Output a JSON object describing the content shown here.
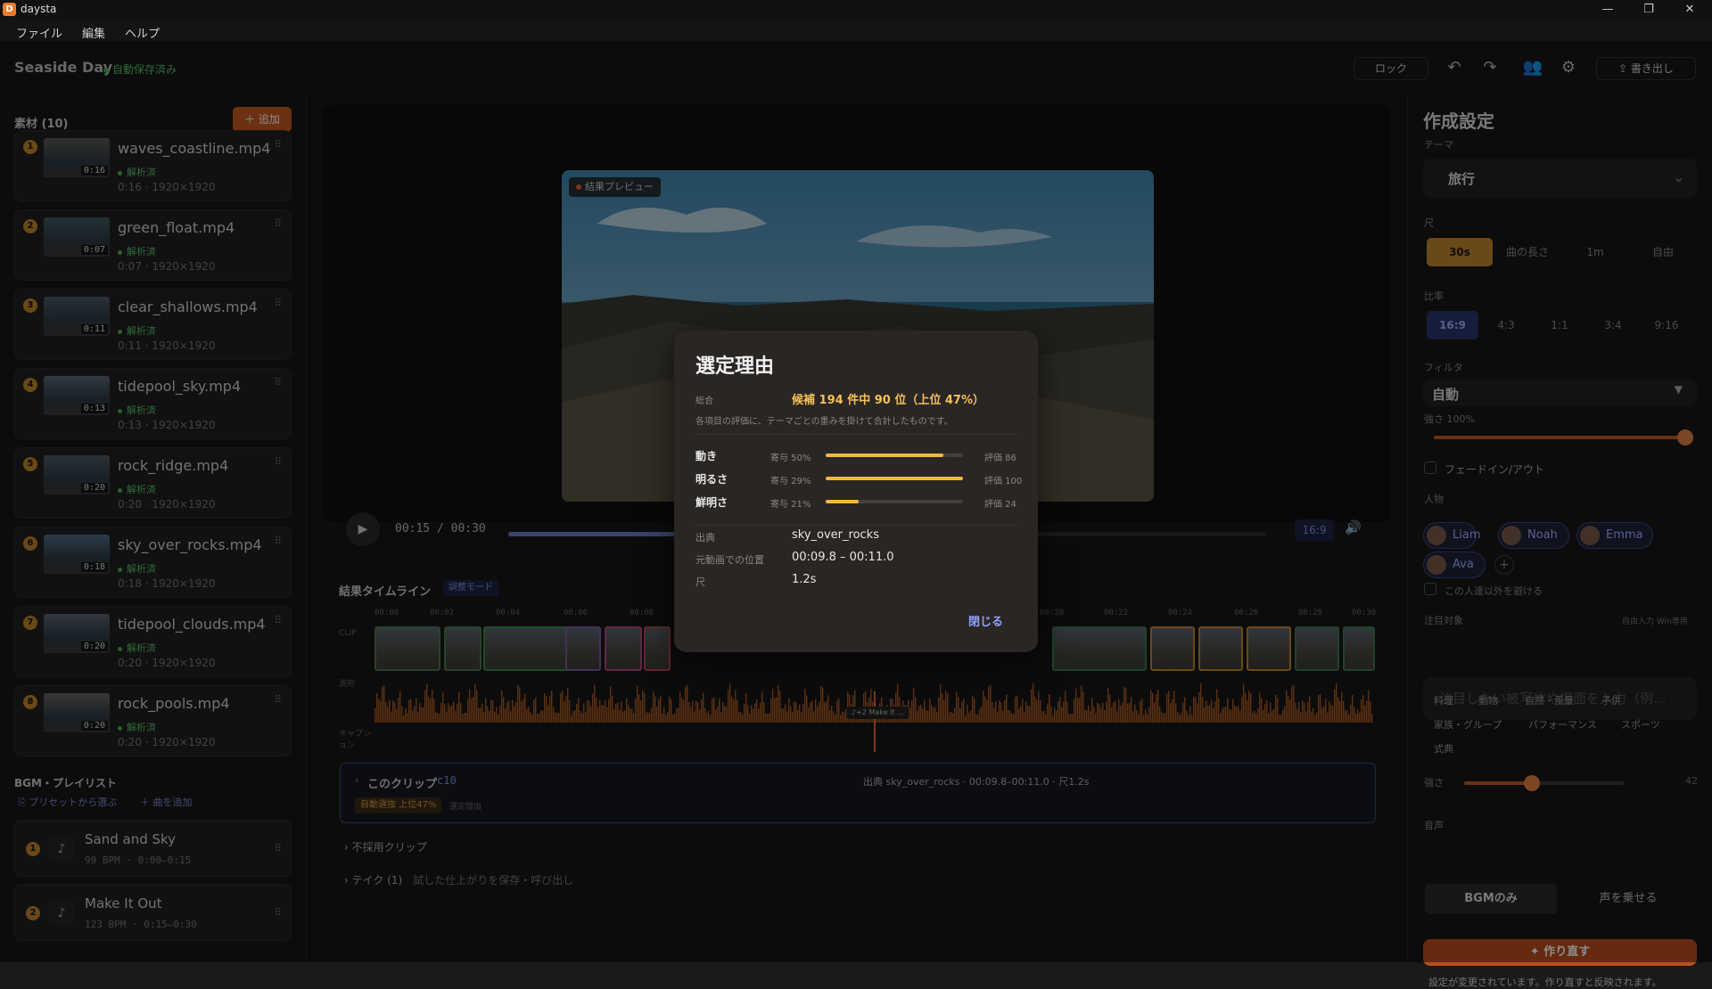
{
  "titlebar": {
    "app_name": "daysta",
    "icon_letter": "D",
    "minimize": "—",
    "maximize": "❐",
    "close": "✕"
  },
  "menubar": {
    "items": [
      "ファイル",
      "編集",
      "ヘルプ"
    ]
  },
  "header": {
    "project_title": "Seaside Day",
    "autosave": "自動保存済み",
    "lock_label": "ロック",
    "export_label": "書き出し"
  },
  "materials": {
    "title": "素材 (10)",
    "add_label": "＋ 追加",
    "clips": [
      {
        "num": "1",
        "name": "waves_coastline.mp4",
        "duration": "0:16",
        "status": "解析済",
        "meta": "0:16 · 1920×1920",
        "thumb": "#5b5a54"
      },
      {
        "num": "2",
        "name": "green_float.mp4",
        "duration": "0:07",
        "status": "解析済",
        "meta": "0:07 · 1920×1920",
        "thumb": "#3f5a66"
      },
      {
        "num": "3",
        "name": "clear_shallows.mp4",
        "duration": "0:11",
        "status": "解析済",
        "meta": "0:11 · 1920×1920",
        "thumb": "#4a5a68"
      },
      {
        "num": "4",
        "name": "tidepool_sky.mp4",
        "duration": "0:13",
        "status": "解析済",
        "meta": "0:13 · 1920×1920",
        "thumb": "#5a6878"
      },
      {
        "num": "5",
        "name": "rock_ridge.mp4",
        "duration": "0:20",
        "status": "解析済",
        "meta": "0:20 · 1920×1920",
        "thumb": "#4e5a66"
      },
      {
        "num": "6",
        "name": "sky_over_rocks.mp4",
        "duration": "0:18",
        "status": "解析済",
        "meta": "0:18 · 1920×1920",
        "thumb": "#4f6c8a"
      },
      {
        "num": "7",
        "name": "tidepool_clouds.mp4",
        "duration": "0:20",
        "status": "解析済",
        "meta": "0:20 · 1920×1920",
        "thumb": "#5a6470"
      },
      {
        "num": "8",
        "name": "rock_pools.mp4",
        "duration": "0:20",
        "status": "解析済",
        "meta": "0:20 · 1920×1920",
        "thumb": "#6a6660"
      }
    ]
  },
  "bgm": {
    "title": "BGM・プレイリスト",
    "preset_link": "プリセットから選ぶ",
    "add_link": "＋ 曲を追加",
    "tracks": [
      {
        "num": "1",
        "name": "Sand and Sky",
        "meta": "99 BPM · 0:00–0:15"
      },
      {
        "num": "2",
        "name": "Make It Out",
        "meta": "123 BPM · 0:15–0:30"
      }
    ]
  },
  "preview": {
    "tag": "結果プレビュー",
    "time": "00:15 / 00:30",
    "progress": 0.5,
    "ratio": "16:9"
  },
  "timeline": {
    "title": "結果タイムライン",
    "mode": "調整モード",
    "ticks": [
      "00:00",
      "00:02",
      "00:04",
      "00:06",
      "00:08",
      "00:20",
      "00:22",
      "00:24",
      "00:26",
      "00:28",
      "00:30"
    ],
    "row_clip": "CLIP",
    "row_audio": "波形",
    "row_caption": "キャプション",
    "playhead_label": "♪+2 Make It …"
  },
  "clip_info": {
    "title": "このクリップ",
    "id": "c10",
    "meta": "出典 sky_over_rocks · 00:09.8–00:11.0 · 尺1.2s",
    "badge": "自動選抜 上位47%",
    "sub": "選定理由"
  },
  "collapsibles": {
    "rejected": "不採用クリップ",
    "takes": "テイク (1)",
    "takes_sub": "試した仕上がりを保存・呼び出し"
  },
  "settings": {
    "title": "作成設定",
    "theme_label": "テーマ",
    "theme_value": "旅行",
    "length_label": "尺",
    "length_options": [
      "30s",
      "曲の長さ",
      "1m",
      "自由"
    ],
    "ratio_label": "比率",
    "ratio_options": [
      "16:9",
      "4:3",
      "1:1",
      "3:4",
      "9:16"
    ],
    "filter_label": "フィルタ",
    "filter_value": "自動",
    "strength_label": "強さ 100%",
    "strength": 1.0,
    "fade_label": "フェードイン/アウト",
    "people_label": "人物",
    "people": [
      "Liam",
      "Noah",
      "Emma",
      "Ava"
    ],
    "avoid_label": "この人達以外を避ける",
    "focus_label": "注目対象",
    "focus_hint": "自由入力 Win専用",
    "focus_placeholder": "注目したい被写体や場面を入力（例…",
    "tags": [
      "料理",
      "動物",
      "自然・風景",
      "子供",
      "家族・グループ",
      "パフォーマンス",
      "スポーツ",
      "式典"
    ],
    "focus_strength_label": "強さ",
    "focus_strength_value": "42",
    "focus_strength": 0.42,
    "audio_label": "音声",
    "audio_options": [
      "BGMのみ",
      "声を乗せる"
    ],
    "remake_label": "作り直す",
    "remake_note": "設定が変更されています。作り直すと反映されます。"
  },
  "modal": {
    "title": "選定理由",
    "overall_label": "総合",
    "rank": "候補 194 件中 90 位（上位 47%）",
    "note": "各項目の評価に、テーマごとの重みを掛けて合計したものです。",
    "metrics": [
      {
        "name": "動き",
        "weight": "寄与 50%",
        "value": 0.86,
        "score": "評価 86"
      },
      {
        "name": "明るさ",
        "weight": "寄与 29%",
        "value": 1.0,
        "score": "評価 100"
      },
      {
        "name": "鮮明さ",
        "weight": "寄与 21%",
        "value": 0.24,
        "score": "評価 24"
      }
    ],
    "source_label": "出典",
    "source_value": "sky_over_rocks",
    "position_label": "元動画での位置",
    "position_value": "00:09.8 – 00:11.0",
    "length_label": "尺",
    "length_value": "1.2s",
    "close_label": "閉じる"
  }
}
